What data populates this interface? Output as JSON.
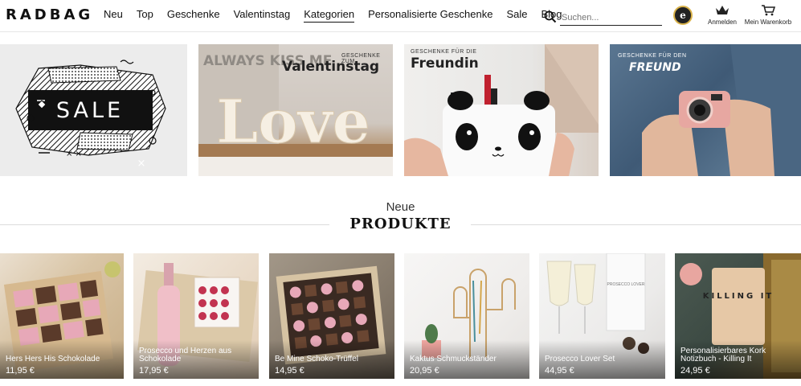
{
  "header": {
    "logo": "RADBAG",
    "nav": [
      "Neu",
      "Top",
      "Geschenke",
      "Valentinstag",
      "Kategorien",
      "Personalisierte Geschenke",
      "Sale",
      "Blog"
    ],
    "active_nav": "Kategorien",
    "search": {
      "placeholder": "Suchen..."
    },
    "trust_badge": "e",
    "login_label": "Anmelden",
    "cart_label": "Mein Warenkorb"
  },
  "categories": {
    "sale": {
      "text": "SALE"
    },
    "valentine": {
      "kicker": "GESCHENKE ZUM",
      "title": "Valentinstag",
      "sign_text": "Love",
      "bg_words": "ALWAYS KISS ME"
    },
    "girlfriend": {
      "kicker": "GESCHENKE FÜR DIE",
      "title": "Freundin"
    },
    "boyfriend": {
      "kicker": "GESCHENKE FÜR DEN",
      "title": "FREUND"
    }
  },
  "section": {
    "small": "Neue",
    "big": "PRODUKTE"
  },
  "products": [
    {
      "name": "Hers Hers His Schokolade",
      "price": "11,95 €"
    },
    {
      "name": "Prosecco und Herzen aus Schokolade",
      "price": "17,95 €"
    },
    {
      "name": "Be Mine Schoko-Trüffel",
      "price": "14,95 €"
    },
    {
      "name": "Kaktus Schmuckständer",
      "price": "20,95 €"
    },
    {
      "name": "Prosecco Lover Set",
      "price": "44,95 €"
    },
    {
      "name": "Personalisierbares Kork Notizbuch - Killing It",
      "price": "24,95 €"
    }
  ],
  "product_image_text": {
    "bottle_label": "PROSECCO LOVER",
    "notebook_text": "KILLING IT"
  }
}
